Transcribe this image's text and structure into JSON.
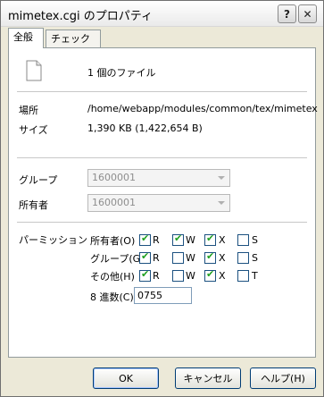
{
  "window": {
    "title": "mimetex.cgi のプロパティ",
    "help_button": "?",
    "close_button": "✕"
  },
  "tabs": [
    {
      "label": "全般",
      "active": true
    },
    {
      "label": "チェックサム",
      "active": false
    }
  ],
  "file": {
    "icon": "file-icon",
    "count_label": "1 個のファイル"
  },
  "location": {
    "label": "場所",
    "value": "/home/webapp/modules/common/tex/mimetex"
  },
  "size": {
    "label": "サイズ",
    "value": "1,390 KB (1,422,654 B)"
  },
  "group": {
    "label": "グループ",
    "value": "1600001"
  },
  "owner": {
    "label": "所有者",
    "value": "1600001"
  },
  "permissions": {
    "label": "パーミッション",
    "rows": [
      {
        "label": "所有者(O)",
        "r": {
          "label": "R",
          "checked": true
        },
        "w": {
          "label": "W",
          "checked": true
        },
        "x": {
          "label": "X",
          "checked": true
        },
        "s": {
          "label": "S",
          "checked": false
        }
      },
      {
        "label": "グループ(G)",
        "r": {
          "label": "R",
          "checked": true
        },
        "w": {
          "label": "W",
          "checked": false
        },
        "x": {
          "label": "X",
          "checked": true
        },
        "s": {
          "label": "S",
          "checked": false
        }
      },
      {
        "label": "その他(H)",
        "r": {
          "label": "R",
          "checked": true
        },
        "w": {
          "label": "W",
          "checked": false
        },
        "x": {
          "label": "X",
          "checked": true
        },
        "s": {
          "label": "T",
          "checked": false
        }
      }
    ],
    "octal_label": "8 進数(C)",
    "octal_value": "0755"
  },
  "buttons": {
    "ok": "OK",
    "cancel": "キャンセル",
    "help": "ヘルプ(H)"
  }
}
